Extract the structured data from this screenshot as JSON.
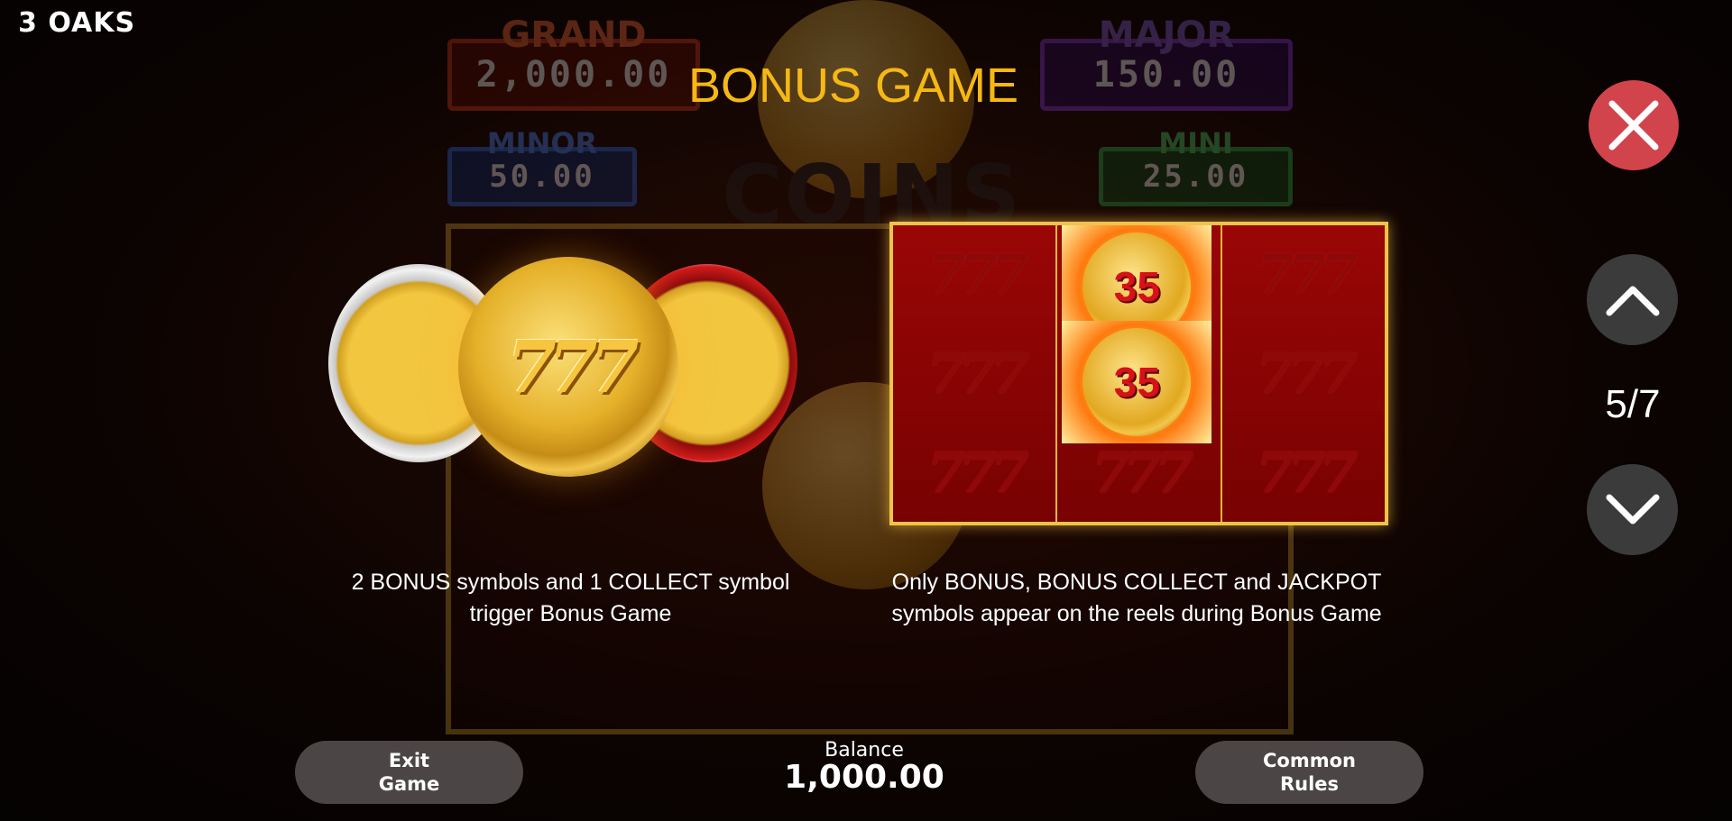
{
  "brand": {
    "logo_text": "3 OAKS"
  },
  "background": {
    "jackpots": [
      {
        "name": "GRAND",
        "value": "2,000.00"
      },
      {
        "name": "MAJOR",
        "value": "150.00"
      },
      {
        "name": "MINOR",
        "value": "50.00"
      },
      {
        "name": "MINI",
        "value": "25.00"
      }
    ],
    "game_title": "COINS"
  },
  "page": {
    "title": "BONUS GAME",
    "indicator": "5/7"
  },
  "illustrations": {
    "coin_symbol": "777",
    "bonus_coin_value_1": "35",
    "bonus_coin_value_2": "35",
    "reel_symbol": "777"
  },
  "descriptions": {
    "left": "2 BONUS symbols and 1 COLLECT symbol trigger Bonus Game",
    "right": "Only BONUS, BONUS COLLECT and JACKPOT symbols appear on the reels during Bonus Game"
  },
  "footer": {
    "exit_label": "Exit\nGame",
    "balance_label": "Balance",
    "balance_value": "1,000.00",
    "common_rules_label": "Common\nRules"
  },
  "icons": {
    "close": "close-icon",
    "up": "chevron-up-icon",
    "down": "chevron-down-icon"
  },
  "colors": {
    "title": "#f5b814",
    "close_button": "#d2444c",
    "nav_button": "#3b3b3b",
    "pill_button": "#4b4645"
  }
}
